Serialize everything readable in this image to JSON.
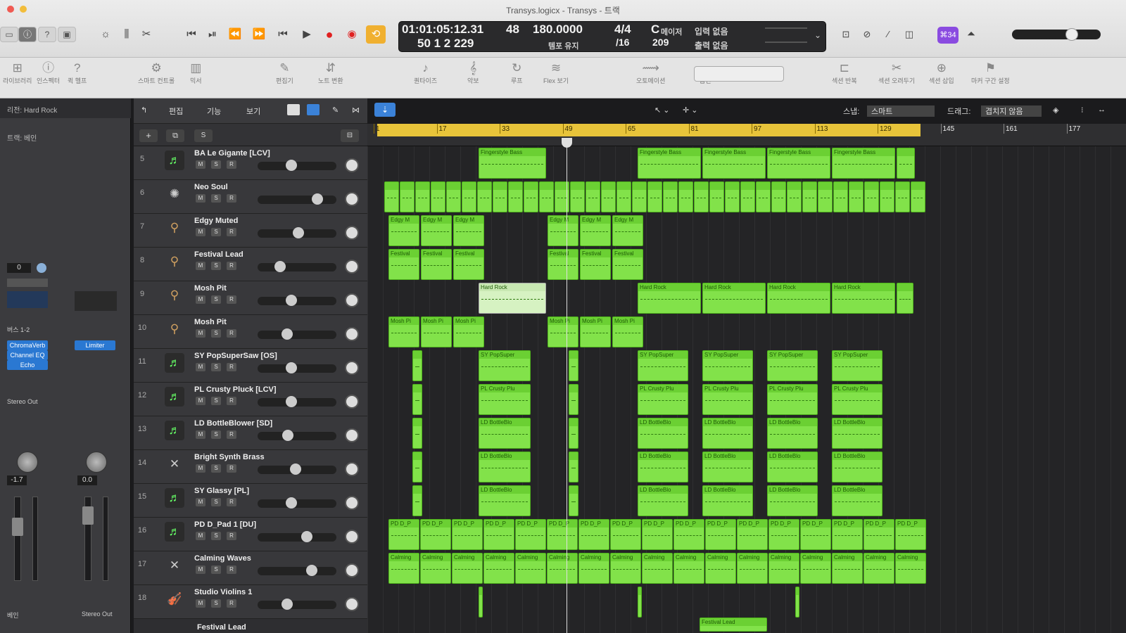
{
  "window": {
    "title": "Transys.logicx - Transys - 트랙"
  },
  "lcd": {
    "position": "01:01:05:12.31",
    "bars_beats": "50  1  2  229",
    "beat_top": "48",
    "beat_sub": "",
    "tempo": "180.0000",
    "tempo_label": "템포 유지",
    "signature": "4/4",
    "division": "/16",
    "key": "C",
    "key_mode": "메이저",
    "key_num": "209",
    "input": "입력 없음",
    "output": "출력 없음"
  },
  "toolbar_badge": "⌘34",
  "toolbar": {
    "items": [
      {
        "icon": "library-icon",
        "label": "라이브러리"
      },
      {
        "icon": "inspector-icon",
        "label": "인스펙터"
      },
      {
        "icon": "quicktime-icon",
        "label": "퀵 헬프"
      },
      {
        "icon": "smart-controls-icon",
        "label": "스마트 컨트롤"
      },
      {
        "icon": "mixer-icon",
        "label": "믹서"
      },
      {
        "icon": "editor-icon",
        "label": "편집기"
      },
      {
        "icon": "region-edit-icon",
        "label": "노트 변환"
      },
      {
        "icon": "quantize-icon",
        "label": "퀀타이즈"
      },
      {
        "icon": "score-icon",
        "label": "악보"
      },
      {
        "icon": "loop-icon",
        "label": "루프"
      },
      {
        "icon": "flex-icon",
        "label": "Flex 보기"
      },
      {
        "icon": "automation-icon",
        "label": "오토메이션"
      },
      {
        "icon": "nav-icon",
        "label": "줌인"
      },
      {
        "icon": "section-icon",
        "label": "섹션 반복"
      },
      {
        "icon": "cut-icon",
        "label": "섹션 오려두기"
      },
      {
        "icon": "insert-icon",
        "label": "섹션 삽입"
      },
      {
        "icon": "marker-icon",
        "label": "마커 구간 설정"
      }
    ]
  },
  "inspector": {
    "region_label": "리전: Hard Rock",
    "track_label": "트랙: 베인",
    "strip1": {
      "value": "0",
      "plugins": [
        "ChromaVerb",
        "Channel EQ",
        "Echo"
      ],
      "send": "버스 1-2",
      "output": "Stereo Out",
      "gain": "-1.7",
      "name": "베인"
    },
    "strip2": {
      "plugins": [
        "Limiter"
      ],
      "gain": "0.0",
      "name": "Stereo Out"
    }
  },
  "track_menu": {
    "edit": "편집",
    "function": "기능",
    "view": "보기",
    "snap_label": "스냅:",
    "snap_value": "스마트",
    "drag_label": "드래그:",
    "drag_value": "겹치지 않음"
  },
  "ruler": {
    "bars": [
      "1",
      "17",
      "33",
      "49",
      "65",
      "81",
      "97",
      "113",
      "129",
      "145",
      "161",
      "177"
    ]
  },
  "tracks": [
    {
      "num": "5",
      "name": "BA Le Gigante [LCV]",
      "icon": "synth-icon",
      "vol": 0.42
    },
    {
      "num": "6",
      "name": "Neo Soul",
      "icon": "drum-icon",
      "vol": 0.8
    },
    {
      "num": "7",
      "name": "Edgy Muted",
      "icon": "guitar-icon",
      "vol": 0.52
    },
    {
      "num": "8",
      "name": "Festival Lead",
      "icon": "guitar-icon",
      "vol": 0.25
    },
    {
      "num": "9",
      "name": "Mosh Pit",
      "icon": "guitar-icon",
      "vol": 0.42
    },
    {
      "num": "10",
      "name": "Mosh Pit",
      "icon": "guitar-icon",
      "vol": 0.35
    },
    {
      "num": "11",
      "name": "SY PopSuperSaw [OS]",
      "icon": "synth-icon",
      "vol": 0.42
    },
    {
      "num": "12",
      "name": "PL Crusty Pluck [LCV]",
      "icon": "synth-icon",
      "vol": 0.42
    },
    {
      "num": "13",
      "name": "LD BottleBlower [SD]",
      "icon": "synth-icon",
      "vol": 0.36
    },
    {
      "num": "14",
      "name": "Bright Synth Brass",
      "icon": "synth2-icon",
      "vol": 0.48
    },
    {
      "num": "15",
      "name": "SY Glassy [PL]",
      "icon": "synth-icon",
      "vol": 0.42
    },
    {
      "num": "16",
      "name": "PD D_Pad 1 [DU]",
      "icon": "synth-icon",
      "vol": 0.65
    },
    {
      "num": "17",
      "name": "Calming Waves",
      "icon": "synth2-icon",
      "vol": 0.72
    },
    {
      "num": "18",
      "name": "Studio Violins 1",
      "icon": "violin-icon",
      "vol": 0.35
    }
  ],
  "next_track": "Festival Lead",
  "region_names": {
    "t5": "Fingerstyle Bass",
    "t7": "Edgy M",
    "t8": "Festival",
    "t9": "Hard Rock",
    "t10": "Mosh Pi",
    "t11": "SY PopSuper",
    "t12": "PL Crusty Plu",
    "t13": "LD BottleBlo",
    "t16": "PD D_P",
    "t17": "Calming",
    "t19": "Festival Lead"
  },
  "colors": {
    "region": "#82e24a",
    "cycle": "#e8c43a",
    "record": "#e02020",
    "cycle_btn": "#f0b030",
    "badge": "#8a4be0"
  }
}
